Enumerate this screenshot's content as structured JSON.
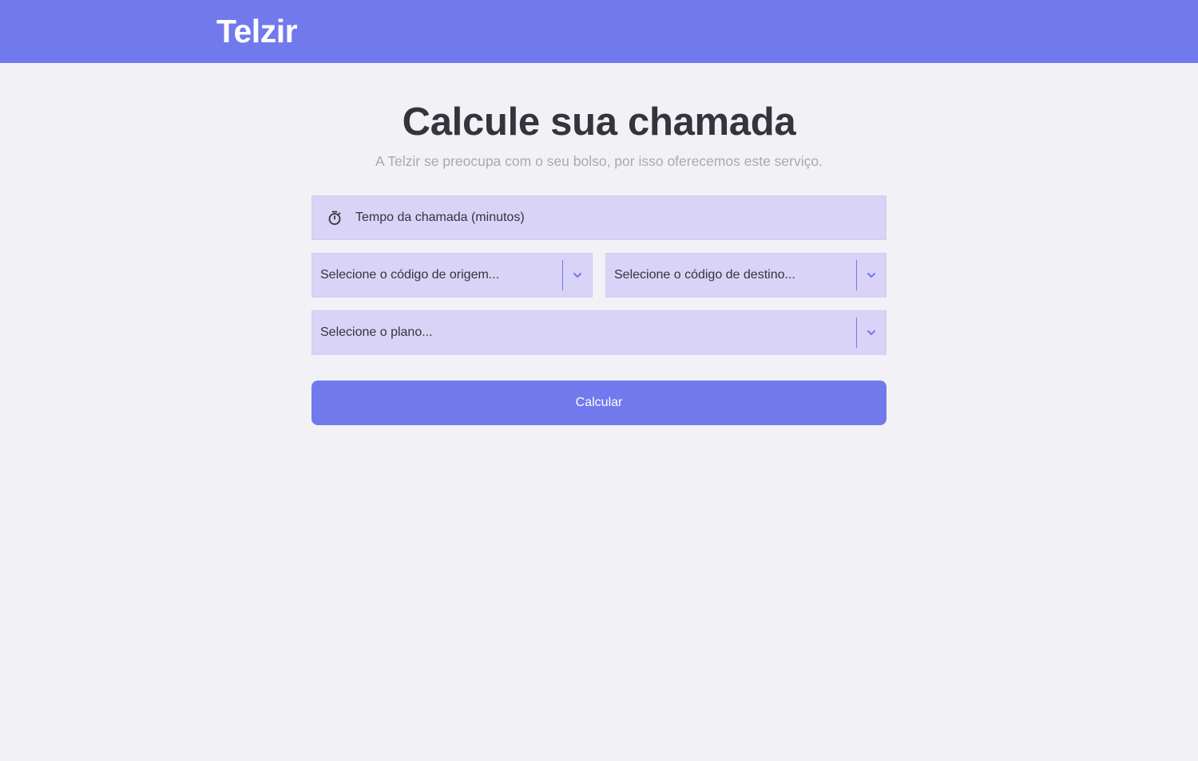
{
  "header": {
    "logo": "Telzir"
  },
  "main": {
    "title": "Calcule sua chamada",
    "subtitle": "A Telzir se preocupa com o seu bolso, por isso oferecemos este serviço."
  },
  "form": {
    "time_placeholder": "Tempo da chamada (minutos)",
    "time_icon": "timer-icon",
    "origin_placeholder": "Selecione o código de origem...",
    "destination_placeholder": "Selecione o código de destino...",
    "plan_placeholder": "Selecione o plano...",
    "dropdown_icon": "chevron-down-icon",
    "submit_label": "Calcular"
  },
  "colors": {
    "accent": "#7179ed",
    "field_background": "#d9d3f7",
    "page_background": "#f2f2f6",
    "title_text": "#35333c",
    "subtitle_text": "#a9a8b3"
  }
}
